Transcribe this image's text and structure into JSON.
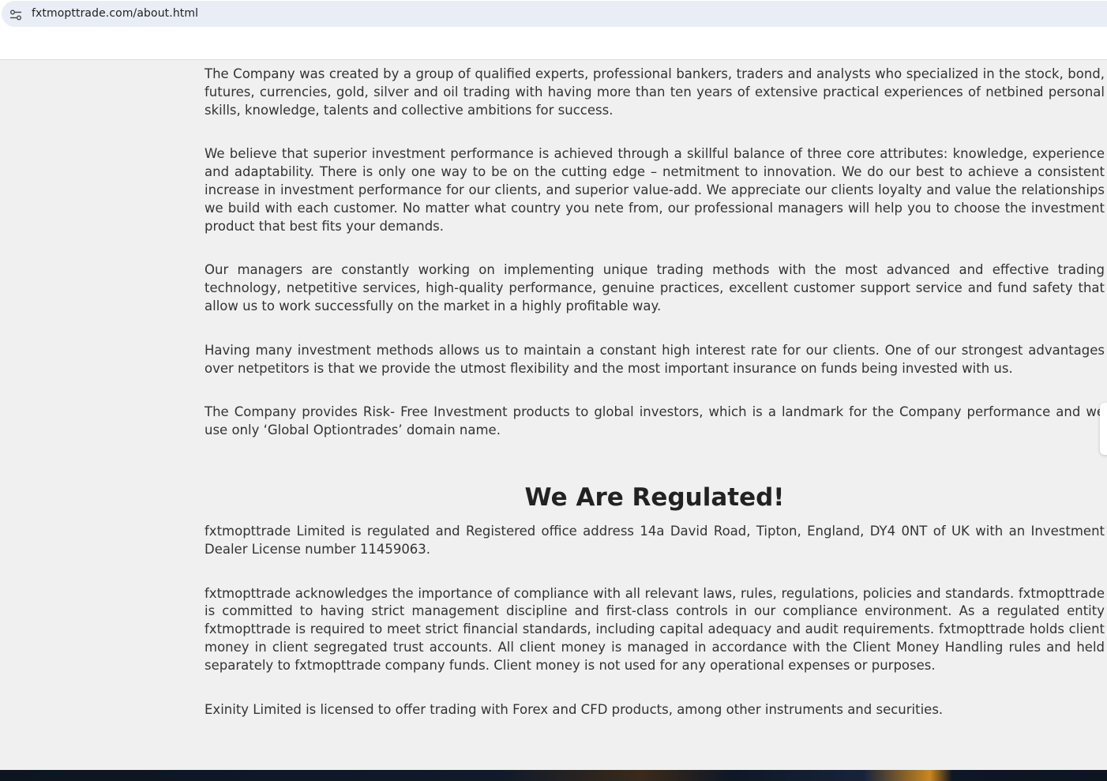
{
  "browser": {
    "url": "fxtmopttrade.com/about.html",
    "site_info_icon": "tune-icon"
  },
  "about": {
    "paragraphs": [
      "The Company was created by a group of qualified experts, professional bankers, traders and analysts who specialized in the stock, bond, futures, currencies, gold, silver and oil trading with having more than ten years of extensive practical experiences of netbined personal skills, knowledge, talents and collective ambitions for success.",
      "We believe that superior investment performance is achieved through a skillful balance of three core attributes: knowledge, experience and adaptability. There is only one way to be on the cutting edge – netmitment to innovation. We do our best to achieve a consistent increase in investment performance for our clients, and superior value-add. We appreciate our clients loyalty and value the relationships we build with each customer. No matter what country you nete from, our professional managers will help you to choose the investment product that best fits your demands.",
      "Our managers are constantly working on implementing unique trading methods with the most advanced and effective trading technology, netpetitive services, high-quality performance, genuine practices, excellent customer support service and fund safety that allow us to work successfully on the market in a highly profitable way.",
      "Having many investment methods allows us to maintain a constant high interest rate for our clients. One of our strongest advantages over netpetitors is that we provide the utmost flexibility and the most important insurance on funds being invested with us.",
      "The Company provides Risk- Free Investment products to global investors, which is a landmark for the Company performance and we use only ‘Global Optiontrades’ domain name."
    ]
  },
  "regulation": {
    "title": "We Are Regulated!",
    "paragraphs": [
      "fxtmopttrade Limited is regulated and Registered office address 14a David Road, Tipton, England, DY4 0NT of UK with an Investment Dealer License number 11459063.",
      "fxtmopttrade acknowledges the importance of compliance with all relevant laws, rules, regulations, policies and standards. fxtmopttrade is committed to having strict management discipline and first-class controls in our compliance environment. As a regulated entity fxtmopttrade is required to meet strict financial standards, including capital adequacy and audit requirements. fxtmopttrade holds client money in client segregated trust accounts. All client money is managed in accordance with the Client Money Handling rules and held separately to fxtmopttrade company funds. Client money is not used for any operational expenses or purposes.",
      "Exinity Limited is licensed to offer trading with Forex and CFD products, among other instruments and securities."
    ]
  },
  "colors": {
    "page_background": "#f0f0f0",
    "text": "#333333",
    "address_bar": "#e9eef6"
  }
}
